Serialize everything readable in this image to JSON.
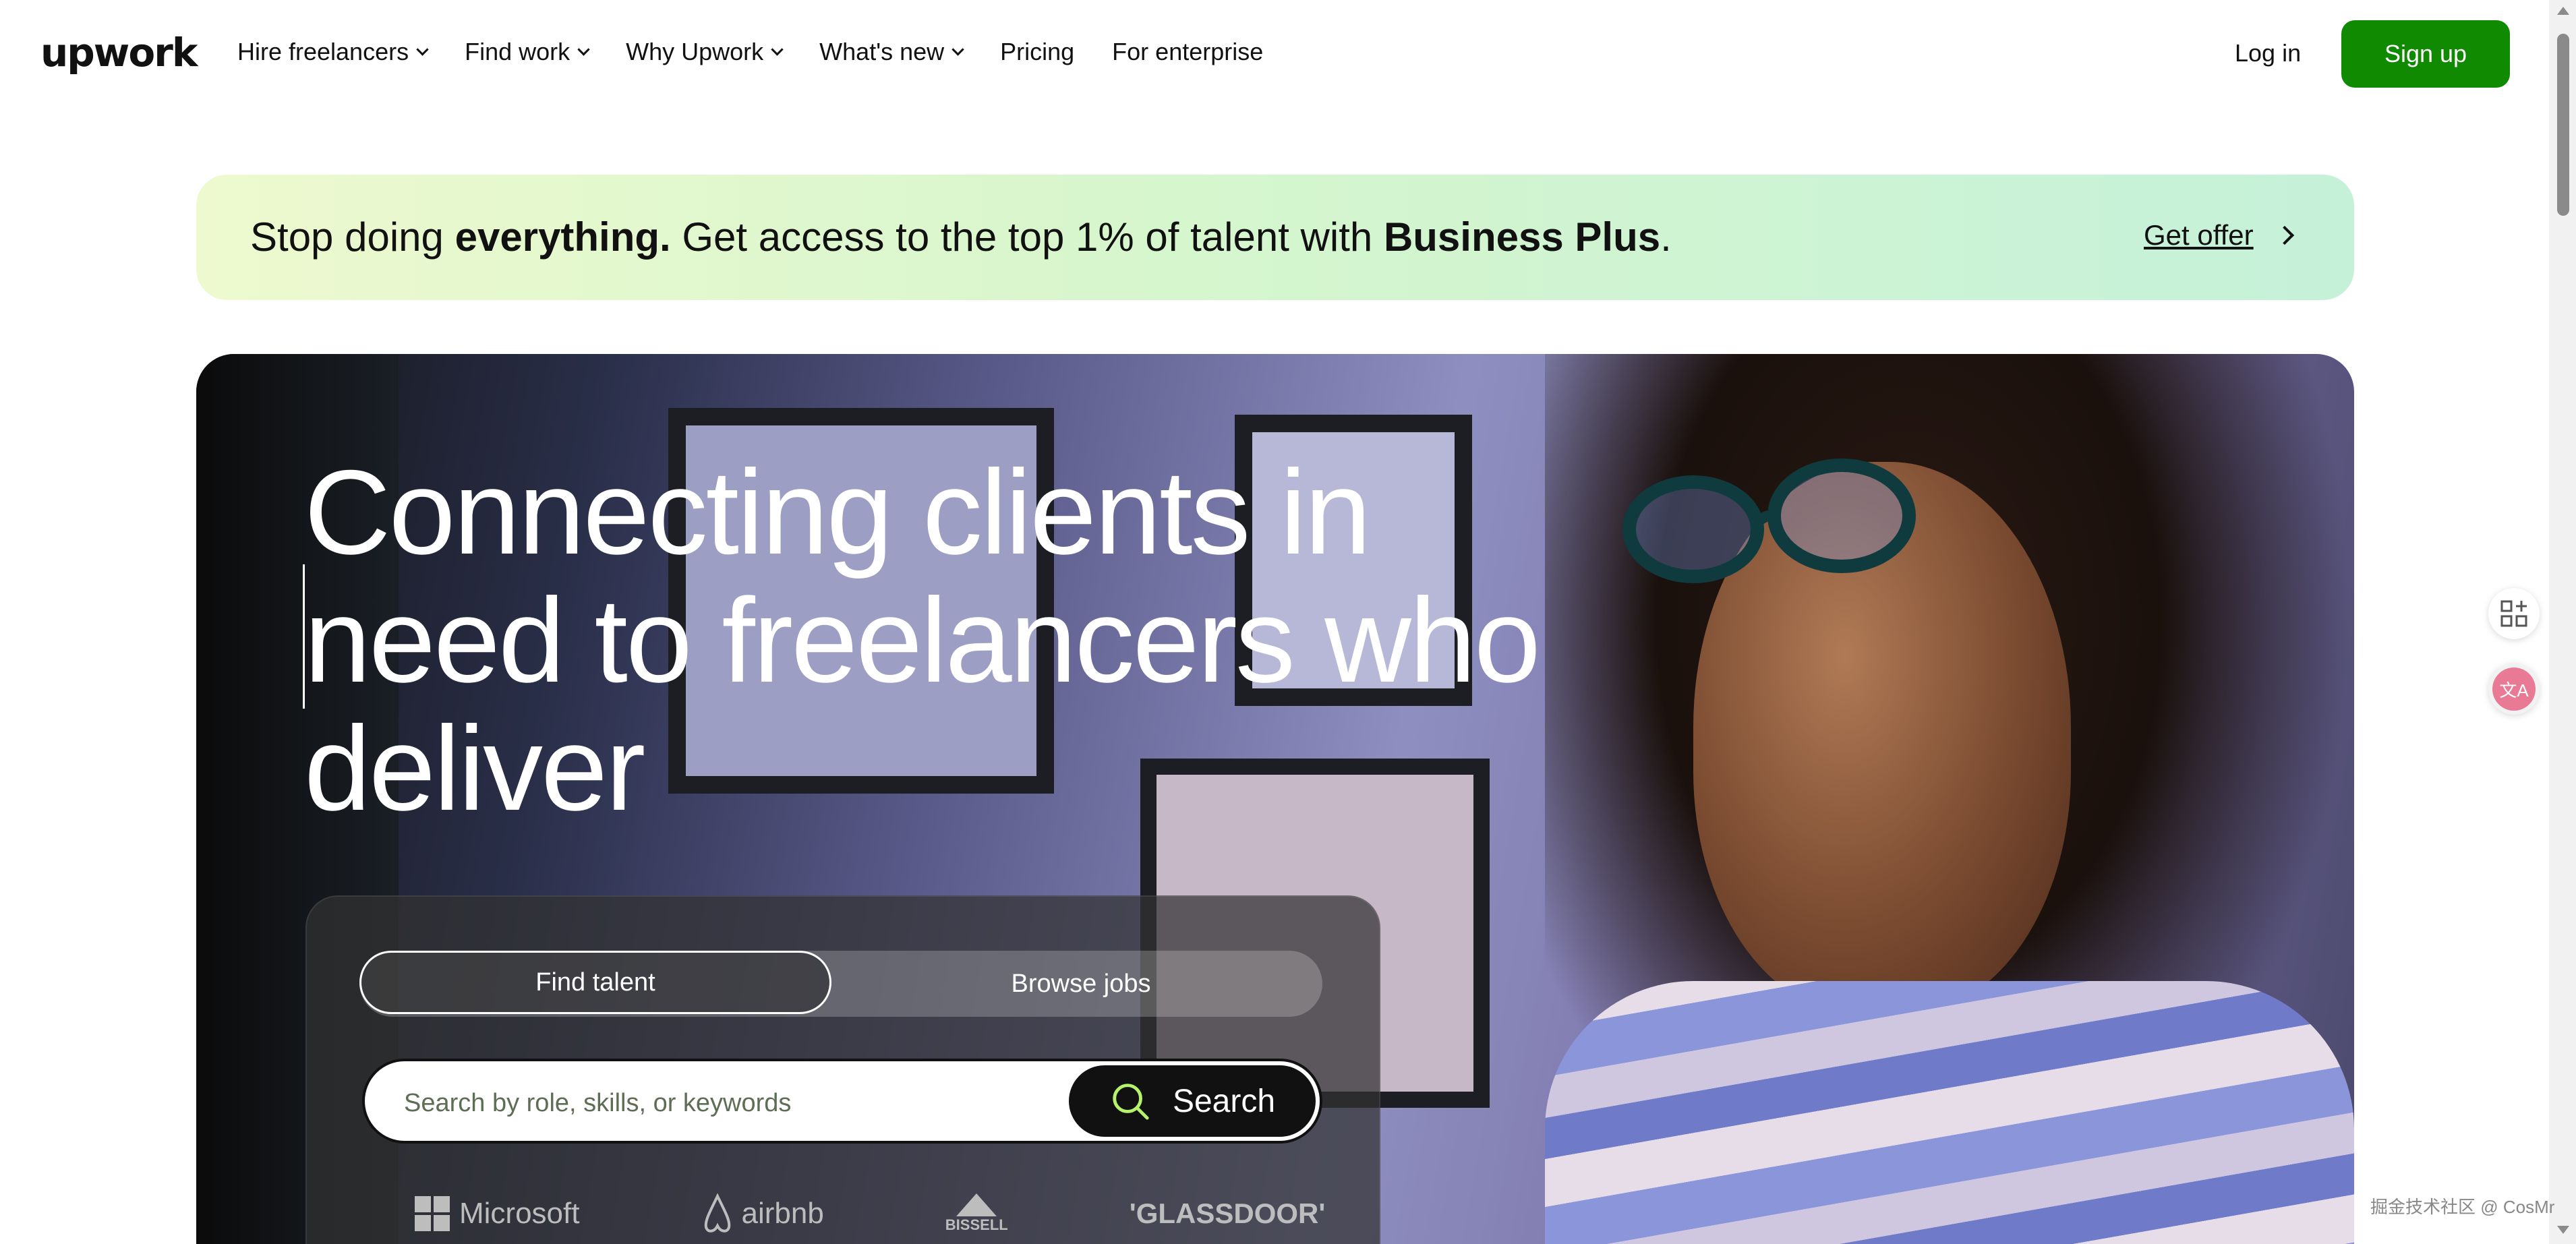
{
  "header": {
    "logo": "upwork",
    "nav": [
      {
        "label": "Hire freelancers",
        "dropdown": true
      },
      {
        "label": "Find work",
        "dropdown": true
      },
      {
        "label": "Why Upwork",
        "dropdown": true
      },
      {
        "label": "What's new",
        "dropdown": true
      },
      {
        "label": "Pricing",
        "dropdown": false
      },
      {
        "label": "For enterprise",
        "dropdown": false
      }
    ],
    "login": "Log in",
    "signup": "Sign up"
  },
  "promo": {
    "text_1": "Stop doing ",
    "text_bold_1": "everything.",
    "text_2": " Get access to the top 1% of talent with ",
    "text_bold_2": "Business Plus",
    "text_3": ".",
    "cta": "Get offer"
  },
  "hero": {
    "headline": "Connecting clients in need to freelancers who deliver",
    "tabs": {
      "active": "Find talent",
      "inactive": "Browse jobs"
    },
    "search": {
      "placeholder": "Search by role, skills, or keywords",
      "button": "Search"
    },
    "brands": [
      "Microsoft",
      "airbnb",
      "BISSELL",
      "'GLASSDOOR'"
    ]
  },
  "watermark": "掘金技术社区 @ CosMr",
  "colors": {
    "brand_green": "#108a00",
    "promo_gradient_start": "#eef9cf",
    "promo_gradient_end": "#c5f1d9",
    "search_button": "#111111",
    "search_icon_accent": "#b6f36a"
  }
}
